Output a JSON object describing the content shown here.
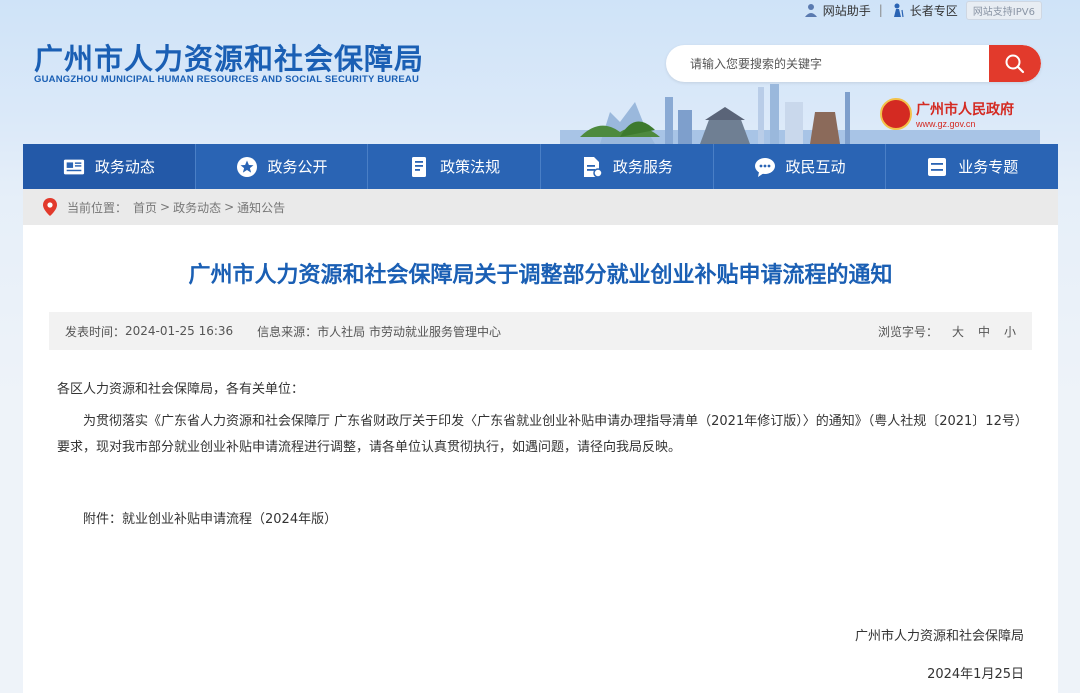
{
  "topbar": {
    "assistant": "网站助手",
    "separator": "|",
    "elderly": "长者专区",
    "ipv6": "网站支持IPV6"
  },
  "header": {
    "title": "广州市人力资源和社会保障局",
    "subtitle": "GUANGZHOU MUNICIPAL HUMAN RESOURCES AND SOCIAL SECURITY BUREAU"
  },
  "search": {
    "placeholder": "请输入您要搜索的关键字"
  },
  "gov": {
    "name": "广州市人民政府",
    "url": "www.gz.gov.cn"
  },
  "nav": {
    "items": [
      {
        "label": "政务动态",
        "icon": "newspaper-icon"
      },
      {
        "label": "政务公开",
        "icon": "star-icon"
      },
      {
        "label": "政策法规",
        "icon": "book-icon"
      },
      {
        "label": "政务服务",
        "icon": "document-icon"
      },
      {
        "label": "政民互动",
        "icon": "chat-icon"
      },
      {
        "label": "业务专题",
        "icon": "list-icon"
      }
    ]
  },
  "breadcrumb": {
    "prefix": "当前位置：",
    "home": "首页",
    "section": "政务动态",
    "current": "通知公告",
    "gt": ">"
  },
  "article": {
    "title": "广州市人力资源和社会保障局关于调整部分就业创业补贴申请流程的通知",
    "publish_label": "发表时间：",
    "publish_time": "2024-01-25 16:36",
    "source_label": "信息来源：",
    "source": "市人社局 市劳动就业服务管理中心",
    "font_label": "浏览字号：",
    "font_large": "大",
    "font_medium": "中",
    "font_small": "小",
    "greeting": "各区人力资源和社会保障局，各有关单位：",
    "paragraph": "为贯彻落实《广东省人力资源和社会保障厅 广东省财政厅关于印发〈广东省就业创业补贴申请办理指导清单（2021年修订版）〉的通知》（粤人社规〔2021〕12号）要求，现对我市部分就业创业补贴申请流程进行调整，请各单位认真贯彻执行，如遇问题，请径向我局反映。",
    "attachment": "附件：就业创业补贴申请流程（2024年版）",
    "signer": "广州市人力资源和社会保障局",
    "date": "2024年1月25日"
  },
  "colors": {
    "brand_blue": "#1a5fb4",
    "nav_blue": "#2a64b4",
    "search_red": "#e23a2c",
    "gov_red": "#d42a22"
  }
}
